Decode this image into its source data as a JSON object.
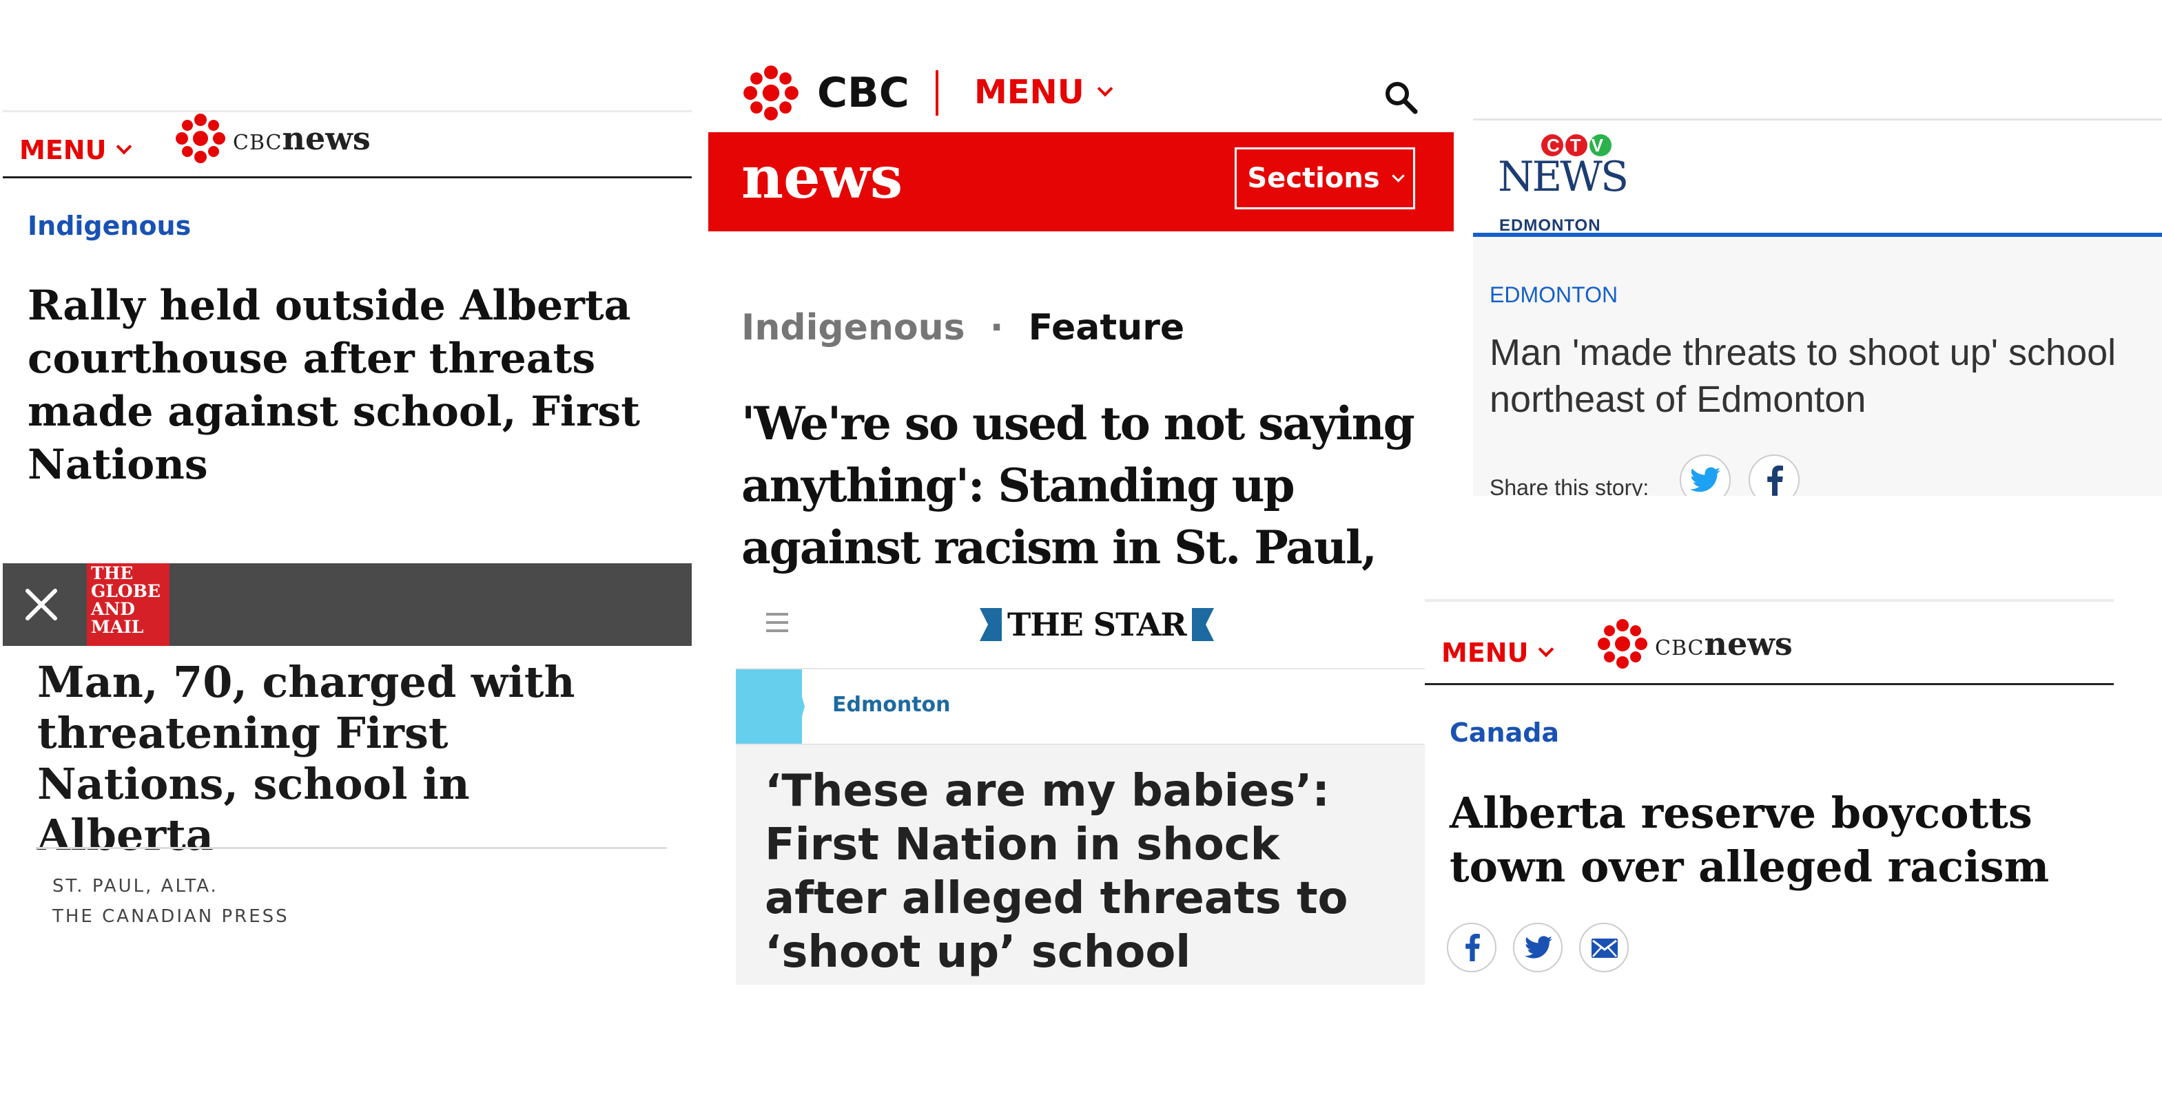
{
  "colors": {
    "cbc_red": "#e60505",
    "cbc_blue": "#1a52b3",
    "dark_gray": "#4a4a4a",
    "globe_red": "#d62027",
    "star_cyan": "#67cfee",
    "star_blue": "#1d6aa0",
    "ctv_blue": "#1560c9"
  },
  "panel_cbc_rally": {
    "menu_label": "MENU",
    "logo_cbc": "CBC",
    "logo_news": "news",
    "category": "Indigenous",
    "headline": "Rally held outside Alberta courthouse after threats made against school, First Nations"
  },
  "panel_globe": {
    "close_icon": "close-icon",
    "logo_lines": [
      "THE",
      "GLOBE",
      "AND",
      "MAIL"
    ],
    "headline": "Man, 70, charged with threatening First Nations, school in Alberta",
    "dateline": "ST. PAUL, ALTA.",
    "source": "THE CANADIAN PRESS"
  },
  "panel_cbc_feature": {
    "logo_text": "CBC",
    "menu_label": "MENU",
    "search_icon": "search-icon",
    "news_label": "news",
    "sections_label": "Sections",
    "category": "Indigenous",
    "separator": "·",
    "type": "Feature",
    "headline": "'We're so used to not saying anything': Standing up against racism in St. Paul, Alta."
  },
  "panel_star": {
    "menu_icon": "hamburger-icon",
    "logo": "THE STAR",
    "section": "Edmonton",
    "headline": "‘These are my babies’: First Nation in shock after alleged threats to ‘shoot up’ school"
  },
  "panel_ctv": {
    "logo_ctv": "CTV",
    "logo_news": "NEWS",
    "logo_city": "EDMONTON",
    "section": "EDMONTON",
    "headline": "Man 'made threats to shoot up' school northeast of Edmonton",
    "share_label": "Share this story:",
    "share_icons": [
      "twitter-icon",
      "facebook-icon"
    ]
  },
  "panel_cbc_boycott": {
    "menu_label": "MENU",
    "logo_cbc": "CBC",
    "logo_news": "news",
    "category": "Canada",
    "headline": "Alberta reserve boycotts town over alleged racism",
    "share_icons": [
      "facebook-icon",
      "twitter-icon",
      "email-icon"
    ]
  }
}
